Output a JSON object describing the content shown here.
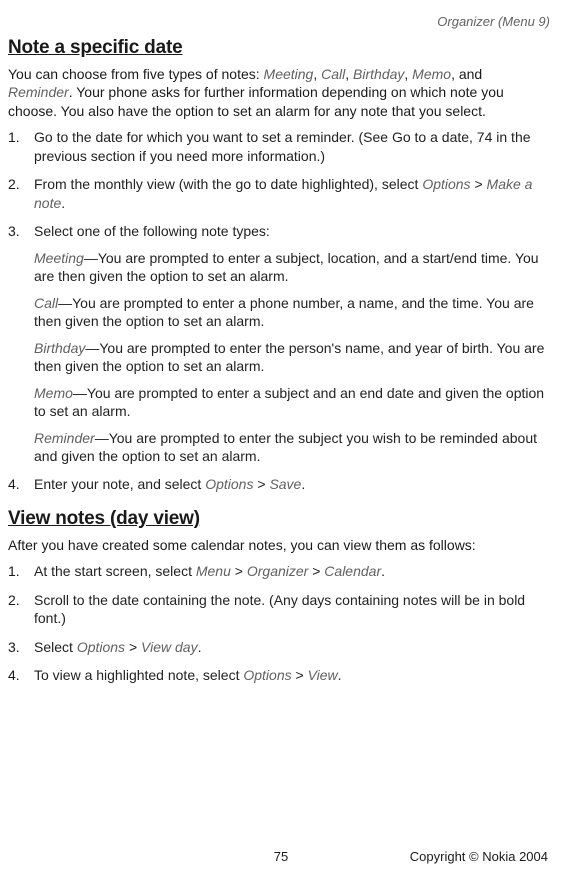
{
  "header": {
    "running": "Organizer (Menu 9)"
  },
  "section1": {
    "title": "Note a specific date",
    "intro_a": "You can choose from five types of notes: ",
    "intro_types": [
      "Meeting",
      "Call",
      "Birthday",
      "Memo",
      "Reminder"
    ],
    "intro_b": ". Your phone asks for further information depending on which note you choose. You also have the option to set an alarm for any note that you select.",
    "steps": [
      {
        "text": "Go to the date for which you want to set a reminder. (See Go to a date, 74 in the previous section if you need more information.)"
      },
      {
        "pre": "From the monthly view (with the go to date highlighted), select ",
        "em1": "Options",
        "mid": " > ",
        "em2": "Make a note",
        "post": "."
      },
      {
        "text": "Select one of the following note types:",
        "subs": [
          {
            "em": "Meeting",
            "rest": "—You are prompted to enter a subject, location, and a start/end time. You are then given the option to set an alarm."
          },
          {
            "em": "Call",
            "rest": "—You are prompted to enter a phone number, a name, and the time. You are then given the option to set an alarm."
          },
          {
            "em": "Birthday",
            "rest": "—You are prompted to enter the person's name, and year of birth. You are then given the option to set an alarm."
          },
          {
            "em": "Memo",
            "rest": "—You are prompted to enter a subject and an end date and given the option to set an alarm."
          },
          {
            "em": "Reminder",
            "rest": "—You are prompted to enter the subject you wish to be reminded about and given the option to set an alarm."
          }
        ]
      },
      {
        "pre": "Enter your note, and select ",
        "em1": "Options",
        "mid": " > ",
        "em2": "Save",
        "post": "."
      }
    ]
  },
  "section2": {
    "title": "View notes (day view)",
    "intro": "After you have created some calendar notes, you can view them as follows:",
    "steps": [
      {
        "pre": "At the start screen, select ",
        "em1": "Menu",
        "mid1": " > ",
        "em2": "Organizer",
        "mid2": " > ",
        "em3": "Calendar",
        "post": "."
      },
      {
        "text": "Scroll to the date containing the note. (Any days containing notes will be in bold font.)"
      },
      {
        "pre": "Select ",
        "em1": "Options",
        "mid": " > ",
        "em2": "View day",
        "post": "."
      },
      {
        "pre": "To view a highlighted note, select ",
        "em1": "Options",
        "mid": " > ",
        "em2": "View",
        "post": "."
      }
    ]
  },
  "footer": {
    "page": "75",
    "copyright": "Copyright © Nokia 2004"
  }
}
